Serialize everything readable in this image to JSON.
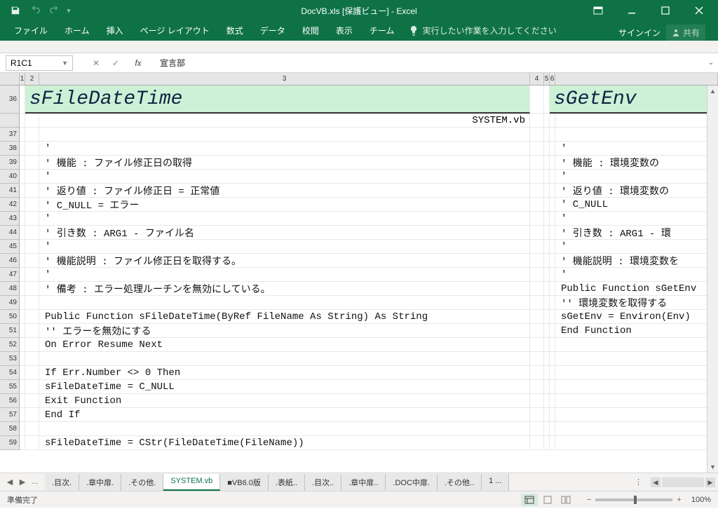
{
  "window": {
    "title": "DocVB.xls [保護ビュー] - Excel",
    "signin": "サインイン",
    "share": "共有"
  },
  "ribbon": {
    "tabs": [
      "ファイル",
      "ホーム",
      "挿入",
      "ページ レイアウト",
      "数式",
      "データ",
      "校閲",
      "表示",
      "チーム"
    ],
    "tell_me": "実行したい作業を入力してください"
  },
  "formula": {
    "name_box": "R1C1",
    "fx": "fx",
    "value": "宣言部"
  },
  "columns": [
    "1",
    "2",
    "3",
    "4",
    "5",
    "6"
  ],
  "left_block": {
    "title": "sFileDateTime",
    "filename": "SYSTEM.vb"
  },
  "right_block": {
    "title": "sGetEnv"
  },
  "rows": [
    {
      "n": "36",
      "big": true,
      "left": "",
      "right": ""
    },
    {
      "n": "",
      "left": "",
      "right": "",
      "filename_row": true
    },
    {
      "n": "37",
      "left": "",
      "right": ""
    },
    {
      "n": "38",
      "left": "'",
      "right": "'"
    },
    {
      "n": "39",
      "left": "' 機能      : ファイル修正日の取得",
      "right": "' 機能      : 環境変数の"
    },
    {
      "n": "40",
      "left": "'",
      "right": "'"
    },
    {
      "n": "41",
      "left": "' 返り値    : ファイル修正日 = 正常値",
      "right": "' 返り値    : 環境変数の"
    },
    {
      "n": "42",
      "left": "'             C_NULL         = エラー",
      "right": "'             C_NULL"
    },
    {
      "n": "43",
      "left": "'",
      "right": "'"
    },
    {
      "n": "44",
      "left": "' 引き数    : ARG1 - ファイル名",
      "right": "' 引き数    : ARG1 - 環"
    },
    {
      "n": "45",
      "left": "'",
      "right": "'"
    },
    {
      "n": "46",
      "left": "' 機能説明  : ファイル修正日を取得する。",
      "right": "' 機能説明  : 環境変数を"
    },
    {
      "n": "47",
      "left": "'",
      "right": "'"
    },
    {
      "n": "48",
      "left": "' 備考      : エラー処理ルーチンを無効にしている。",
      "right": "Public Function sGetEnv"
    },
    {
      "n": "49",
      "left": "",
      "right": " '' 環境変数を取得する"
    },
    {
      "n": "50",
      "left": "Public Function sFileDateTime(ByRef FileName As String) As String",
      "right": " sGetEnv = Environ(Env)"
    },
    {
      "n": "51",
      "left": " '' エラーを無効にする",
      "right": "End Function"
    },
    {
      "n": "52",
      "left": " On Error Resume Next",
      "right": ""
    },
    {
      "n": "53",
      "left": "",
      "right": ""
    },
    {
      "n": "54",
      "left": "  If Err.Number <> 0 Then",
      "right": ""
    },
    {
      "n": "55",
      "left": "    sFileDateTime = C_NULL",
      "right": ""
    },
    {
      "n": "56",
      "left": "    Exit Function",
      "right": ""
    },
    {
      "n": "57",
      "left": "  End If",
      "right": ""
    },
    {
      "n": "58",
      "left": "",
      "right": ""
    },
    {
      "n": "59",
      "left": " sFileDateTime = CStr(FileDateTime(FileName))",
      "right": ""
    }
  ],
  "sheet_tabs": {
    "ellipsis": "...",
    "items": [
      ".目次.",
      ".章中扉.",
      ".その他.",
      "SYSTEM.vb",
      "■VB6.0版",
      ".表紙..",
      ".目次..",
      ".章中扉..",
      ".DOC中扉.",
      ".その他..",
      "1 ..."
    ],
    "active_index": 3,
    "more": "⋮"
  },
  "status": {
    "ready": "準備完了",
    "zoom": "100%"
  }
}
